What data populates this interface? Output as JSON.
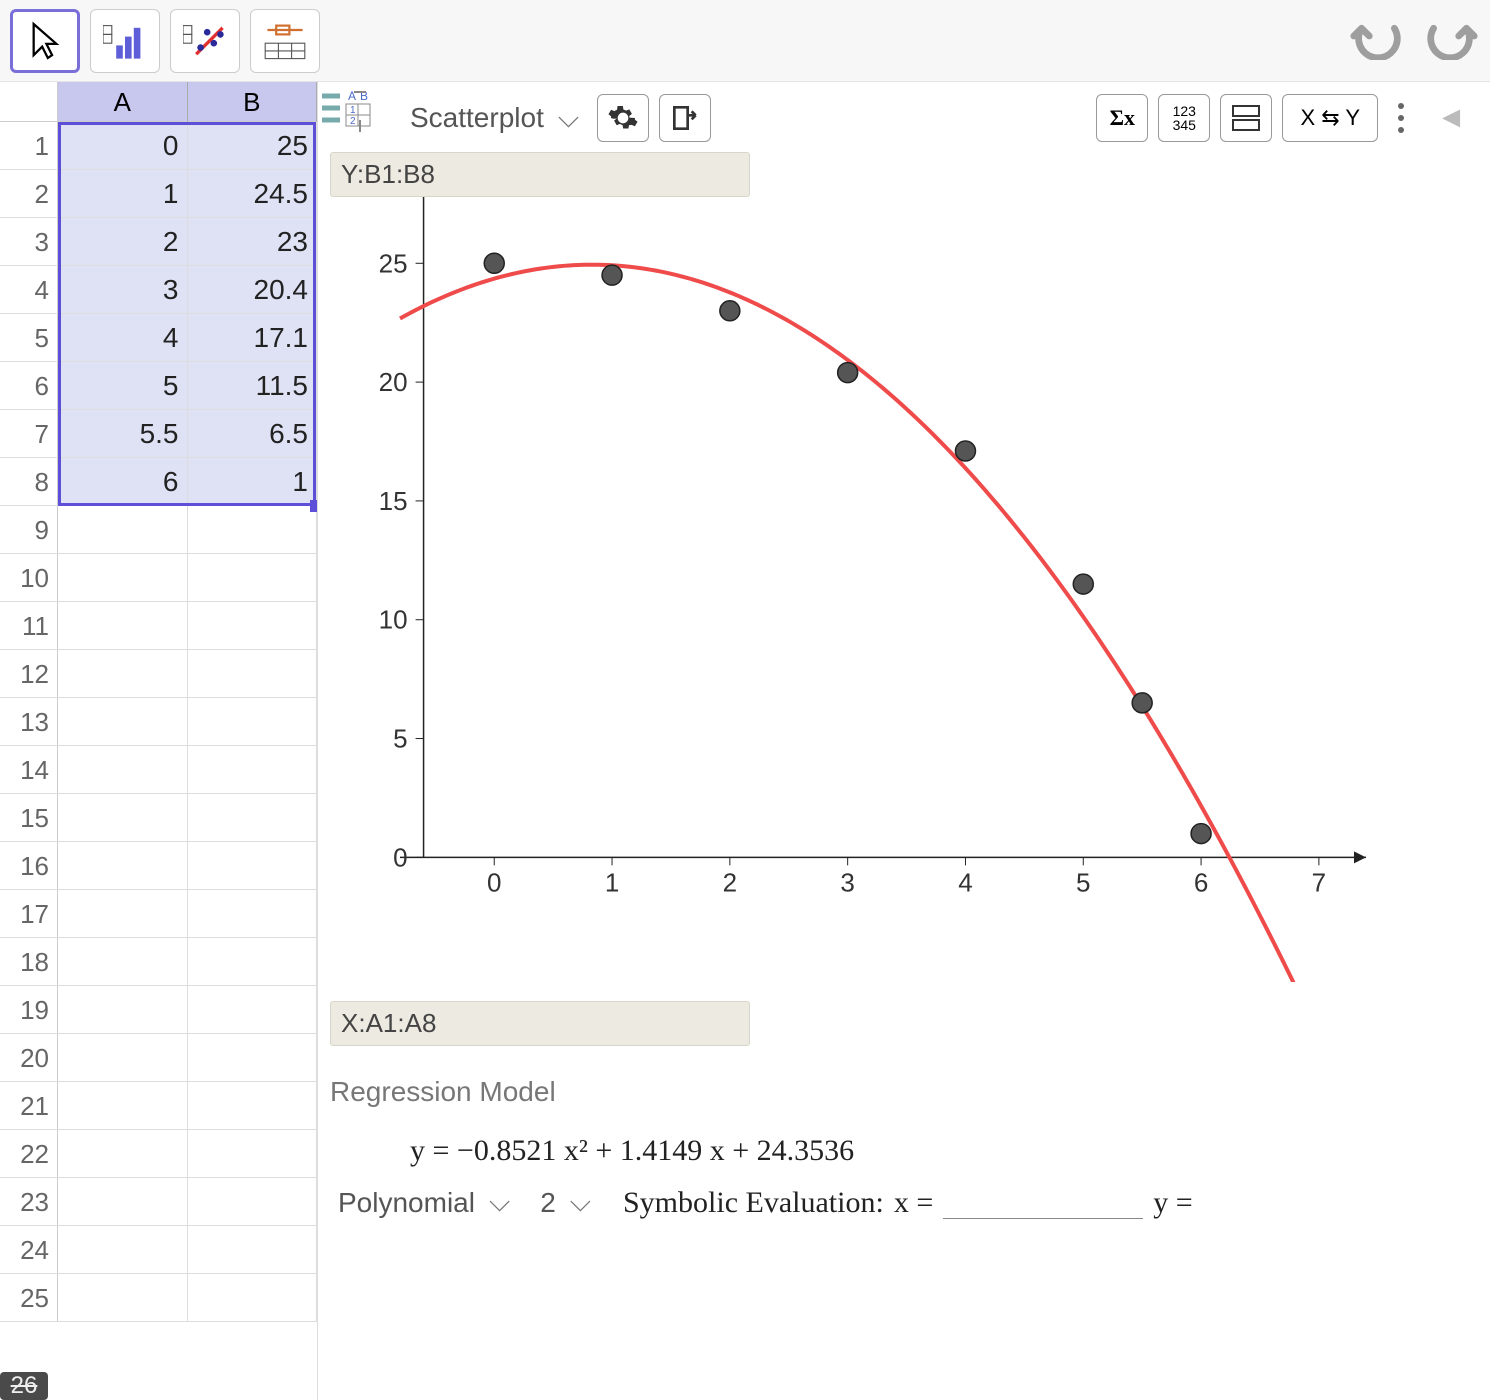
{
  "toolbar": {
    "buttons": [
      "cursor-tool",
      "bar-chart-tool",
      "scatter-tool",
      "table-tool"
    ]
  },
  "spreadsheet": {
    "columns": [
      "A",
      "B"
    ],
    "data": [
      {
        "row": 1,
        "A": "0",
        "B": "25"
      },
      {
        "row": 2,
        "A": "1",
        "B": "24.5"
      },
      {
        "row": 3,
        "A": "2",
        "B": "23"
      },
      {
        "row": 4,
        "A": "3",
        "B": "20.4"
      },
      {
        "row": 5,
        "A": "4",
        "B": "17.1"
      },
      {
        "row": 6,
        "A": "5",
        "B": "11.5"
      },
      {
        "row": 7,
        "A": "5.5",
        "B": "6.5"
      },
      {
        "row": 8,
        "A": "6",
        "B": "1"
      }
    ],
    "empty_rows": [
      9,
      10,
      11,
      12,
      13,
      14,
      15,
      16,
      17,
      18,
      19,
      20,
      21,
      22,
      23,
      24,
      25
    ],
    "cut_row_label": "26",
    "selection": "A1:B8"
  },
  "analysis": {
    "plot_type": "Scatterplot",
    "y_label_prefix": "Y:",
    "y_range": "B1:B8",
    "x_label_prefix": "X:",
    "x_range": "A1:A8",
    "swap_label": "X ⇆ Y",
    "sigma_label": "Σx",
    "nums_label": "123\n345"
  },
  "regression": {
    "section_title": "Regression Model",
    "model_type": "Polynomial",
    "degree": "2",
    "equation": "y = −0.8521 x² + 1.4149 x + 24.3536",
    "symbolic_label": "Symbolic Evaluation:",
    "x_eq": "x =",
    "y_eq": "y ="
  },
  "chart_data": {
    "type": "scatter",
    "title": "",
    "xlabel": "",
    "ylabel": "",
    "x": [
      0,
      1,
      2,
      3,
      4,
      5,
      5.5,
      6
    ],
    "y": [
      25,
      24.5,
      23,
      20.4,
      17.1,
      11.5,
      6.5,
      1
    ],
    "x_ticks": [
      0,
      1,
      2,
      3,
      4,
      5,
      6,
      7
    ],
    "y_ticks": [
      0,
      5,
      10,
      15,
      20,
      25
    ],
    "xlim": [
      -0.8,
      7.4
    ],
    "ylim": [
      -2.3,
      28
    ],
    "fit_curve": {
      "type": "polynomial",
      "coeffs": [
        -0.8521,
        1.4149,
        24.3536
      ],
      "color": "#ef4b4b"
    },
    "point_color": "#555555"
  }
}
